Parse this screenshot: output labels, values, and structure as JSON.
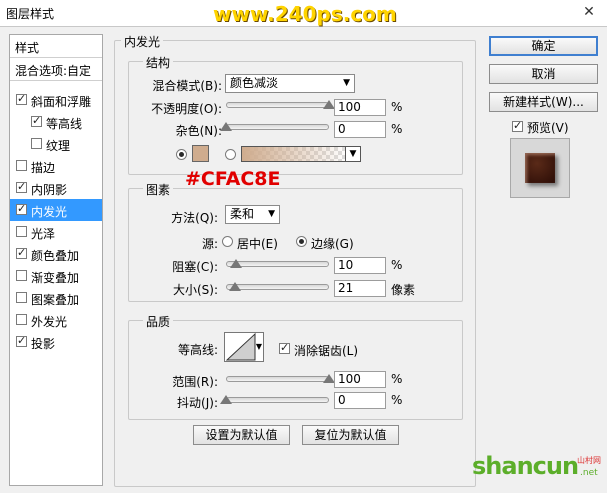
{
  "window": {
    "title": "图层样式",
    "watermark": "www.240ps.com"
  },
  "left_panel": {
    "header": "样式",
    "blend_options": "混合选项:自定",
    "items": [
      {
        "label": "斜面和浮雕",
        "checked": true,
        "indent": false,
        "selected": false
      },
      {
        "label": "等高线",
        "checked": true,
        "indent": true,
        "selected": false
      },
      {
        "label": "纹理",
        "checked": false,
        "indent": true,
        "selected": false
      },
      {
        "label": "描边",
        "checked": false,
        "indent": false,
        "selected": false
      },
      {
        "label": "内阴影",
        "checked": true,
        "indent": false,
        "selected": false
      },
      {
        "label": "内发光",
        "checked": true,
        "indent": false,
        "selected": true
      },
      {
        "label": "光泽",
        "checked": false,
        "indent": false,
        "selected": false
      },
      {
        "label": "颜色叠加",
        "checked": true,
        "indent": false,
        "selected": false
      },
      {
        "label": "渐变叠加",
        "checked": false,
        "indent": false,
        "selected": false
      },
      {
        "label": "图案叠加",
        "checked": false,
        "indent": false,
        "selected": false
      },
      {
        "label": "外发光",
        "checked": false,
        "indent": false,
        "selected": false
      },
      {
        "label": "投影",
        "checked": true,
        "indent": false,
        "selected": false
      }
    ]
  },
  "main": {
    "section_title": "内发光",
    "structure": {
      "title": "结构",
      "blend_mode_label": "混合模式(B):",
      "blend_mode_value": "颜色减淡",
      "opacity_label": "不透明度(O):",
      "opacity_value": "100",
      "opacity_fraction": 1.0,
      "noise_label": "杂色(N):",
      "noise_value": "0",
      "noise_fraction": 0.0,
      "percent": "%",
      "color_swatch": "#cfac8e"
    },
    "annotation": "#CFAC8E",
    "elements": {
      "title": "图素",
      "method_label": "方法(Q):",
      "method_value": "柔和",
      "source_label": "源:",
      "source_center": "居中(E)",
      "source_edge": "边缘(G)",
      "choke_label": "阻塞(C):",
      "choke_value": "10",
      "choke_fraction": 0.1,
      "size_label": "大小(S):",
      "size_value": "21",
      "size_fraction": 0.084,
      "percent": "%",
      "pixels": "像素"
    },
    "quality": {
      "title": "品质",
      "contour_label": "等高线:",
      "antialias_label": "消除锯齿(L)",
      "range_label": "范围(R):",
      "range_value": "100",
      "range_fraction": 1.0,
      "jitter_label": "抖动(J):",
      "jitter_value": "0",
      "jitter_fraction": 0.0,
      "percent": "%"
    },
    "make_default": "设置为默认值",
    "reset_default": "复位为默认值"
  },
  "right": {
    "ok": "确定",
    "cancel": "取消",
    "new_style": "新建样式(W)...",
    "preview": "预览(V)"
  },
  "footer_watermark": {
    "main": "shancun",
    "sub": "山村网",
    "domain": ".net"
  }
}
